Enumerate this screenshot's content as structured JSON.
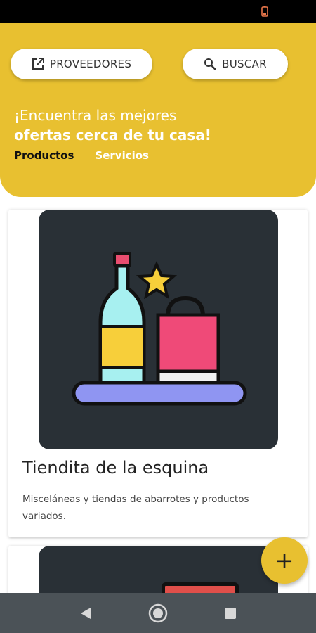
{
  "status_bar": {
    "battery_icon": "battery-low-icon"
  },
  "header": {
    "providers_button": {
      "label": "PROVEEDORES",
      "icon": "open-external-icon"
    },
    "search_button": {
      "label": "BUSCAR",
      "icon": "search-icon"
    },
    "headline_line1": "¡Encuentra las mejores",
    "headline_line2": "ofertas cerca de tu casa!",
    "tabs": [
      {
        "label": "Productos",
        "active": true
      },
      {
        "label": "Servicios",
        "active": false
      }
    ],
    "color": "#e8c030"
  },
  "cards": [
    {
      "title": "Tiendita de la esquina",
      "description": "Misceláneas y tiendas de abarrotes y productos variados.",
      "image_icon": "store-products-icon"
    },
    {
      "image_icon": "toolbox-icon"
    }
  ],
  "fab": {
    "label": "+"
  },
  "nav_bar": {
    "back_icon": "back-triangle-icon",
    "home_icon": "home-circle-icon",
    "recents_icon": "recents-square-icon"
  }
}
